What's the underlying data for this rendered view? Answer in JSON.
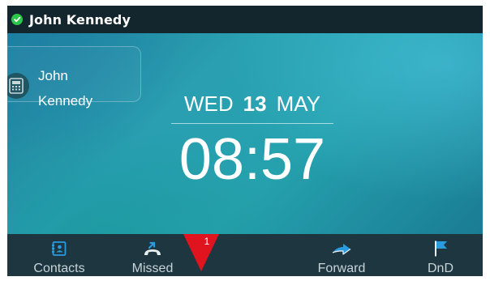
{
  "status_bar": {
    "account_name": "John Kennedy",
    "status_color": "#2cc64a"
  },
  "line_key": {
    "icon": "desk-phone-icon",
    "label_line1": "John",
    "label_line2": "Kennedy"
  },
  "clock": {
    "day_of_week": "WED",
    "day": "13",
    "month": "MAY",
    "time": "08:57"
  },
  "softkeys": [
    {
      "label": "Contacts",
      "icon": "contacts-icon"
    },
    {
      "label": "Missed",
      "icon": "missed-call-icon",
      "badge": "1",
      "badge_color": "#e0141e"
    },
    {
      "label": "Forward",
      "icon": "forward-arrow-icon"
    },
    {
      "label": "DnD",
      "icon": "flag-icon"
    }
  ],
  "colors": {
    "accent_blue": "#1f8fd0"
  }
}
